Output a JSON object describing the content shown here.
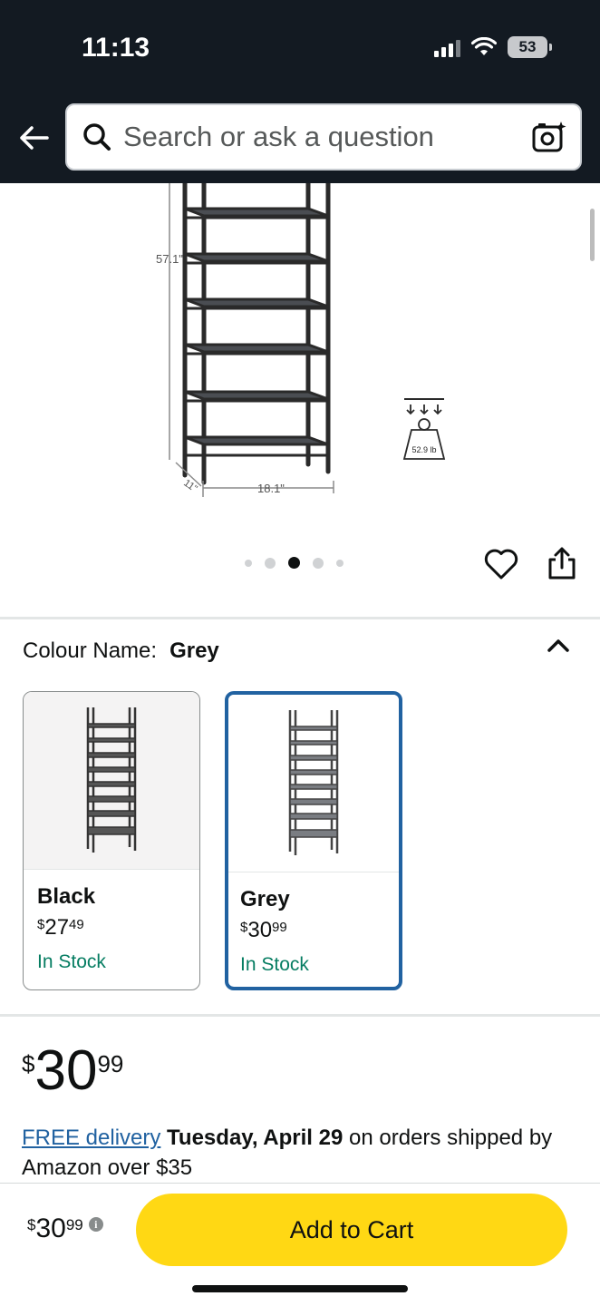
{
  "status_bar": {
    "time": "11:13",
    "battery": "53"
  },
  "search": {
    "placeholder": "Search or ask a question"
  },
  "product_image": {
    "height_label": "57.1\"",
    "width_label": "18.1\"",
    "depth_label": "11\"",
    "weight_label": "52.9 lb"
  },
  "gallery": {
    "image_count": 5,
    "active_index": 2
  },
  "colour": {
    "label": "Colour Name:",
    "selected": "Grey",
    "options": [
      {
        "name": "Black",
        "price_symbol": "$",
        "price_whole": "27",
        "price_cents": "49",
        "stock": "In Stock"
      },
      {
        "name": "Grey",
        "price_symbol": "$",
        "price_whole": "30",
        "price_cents": "99",
        "stock": "In Stock"
      }
    ]
  },
  "price": {
    "symbol": "$",
    "whole": "30",
    "cents": "99"
  },
  "delivery": {
    "link": "FREE delivery",
    "date": "Tuesday, April 29",
    "rest": "on orders shipped by Amazon over $35"
  },
  "bottom_bar": {
    "price_symbol": "$",
    "price_whole": "30",
    "price_cents": "99",
    "add_to_cart_label": "Add to Cart"
  },
  "colors": {
    "header_bg": "#131a22",
    "cart_button": "#ffd814",
    "link": "#2162a1",
    "stock_green": "#067d62",
    "selected_border": "#2162a1"
  }
}
